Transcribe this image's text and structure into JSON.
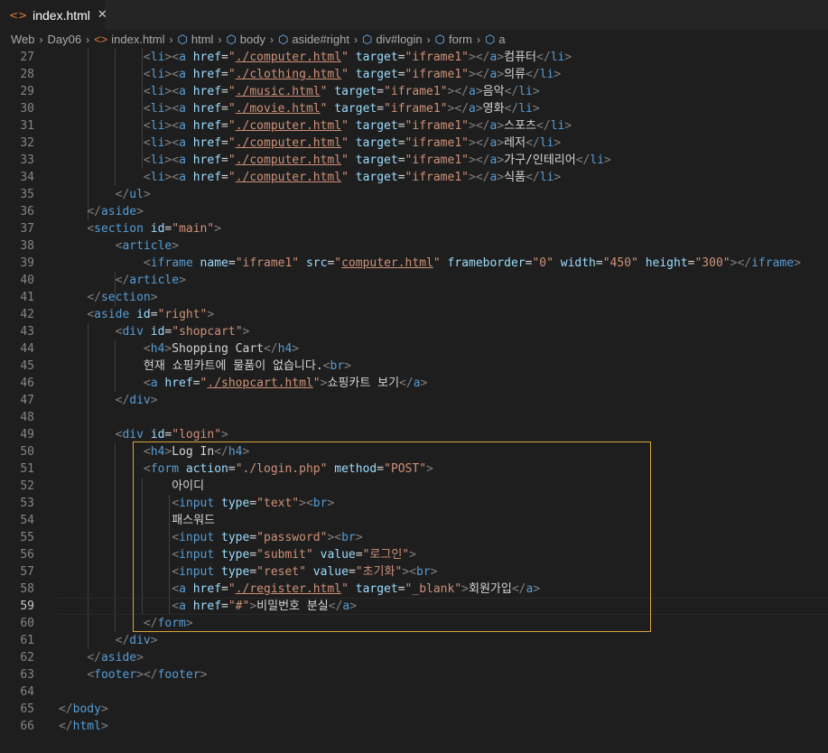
{
  "tab": {
    "icon": "html-file-icon",
    "label": "index.html",
    "close": "✕"
  },
  "breadcrumb": [
    {
      "label": "Web",
      "icon": ""
    },
    {
      "label": "Day06",
      "icon": ""
    },
    {
      "label": "index.html",
      "icon": "html-file-icon"
    },
    {
      "label": "html",
      "icon": "element-cube-icon"
    },
    {
      "label": "body",
      "icon": "element-cube-icon"
    },
    {
      "label": "aside#right",
      "icon": "element-cube-icon"
    },
    {
      "label": "div#login",
      "icon": "element-cube-icon"
    },
    {
      "label": "form",
      "icon": "element-cube-icon"
    },
    {
      "label": "a",
      "icon": "element-cube-icon"
    }
  ],
  "colors": {
    "tag_bracket": "#808080",
    "tag_name": "#569cd6",
    "attr": "#9cdcfe",
    "string": "#ce9178",
    "text": "#d4d4d4",
    "selection_border": "#d7a53a"
  },
  "current_line": 59,
  "lines": [
    {
      "num": "27",
      "text": "            <li><a href=\"./computer.html\" target=\"iframe1\"></a>컴퓨터</li>"
    },
    {
      "num": "28",
      "text": "            <li><a href=\"./clothing.html\" target=\"iframe1\"></a>의류</li>"
    },
    {
      "num": "29",
      "text": "            <li><a href=\"./music.html\" target=\"iframe1\"></a>음악</li>"
    },
    {
      "num": "30",
      "text": "            <li><a href=\"./movie.html\" target=\"iframe1\"></a>영화</li>"
    },
    {
      "num": "31",
      "text": "            <li><a href=\"./computer.html\" target=\"iframe1\"></a>스포츠</li>"
    },
    {
      "num": "32",
      "text": "            <li><a href=\"./computer.html\" target=\"iframe1\"></a>레저</li>"
    },
    {
      "num": "33",
      "text": "            <li><a href=\"./computer.html\" target=\"iframe1\"></a>가구/인테리어</li>"
    },
    {
      "num": "34",
      "text": "            <li><a href=\"./computer.html\" target=\"iframe1\"></a>식품</li>"
    },
    {
      "num": "35",
      "text": "        </ul>"
    },
    {
      "num": "36",
      "text": "    </aside>"
    },
    {
      "num": "37",
      "text": "    <section id=\"main\">"
    },
    {
      "num": "38",
      "text": "        <article>"
    },
    {
      "num": "39",
      "text": "            <iframe name=\"iframe1\" src=\"computer.html\" frameborder=\"0\" width=\"450\" height=\"300\"></iframe>"
    },
    {
      "num": "40",
      "text": "        </article>"
    },
    {
      "num": "41",
      "text": "    </section>"
    },
    {
      "num": "42",
      "text": "    <aside id=\"right\">"
    },
    {
      "num": "43",
      "text": "        <div id=\"shopcart\">"
    },
    {
      "num": "44",
      "text": "            <h4>Shopping Cart</h4>"
    },
    {
      "num": "45",
      "text": "            현재 쇼핑카트에 물품이 없습니다.<br>"
    },
    {
      "num": "46",
      "text": "            <a href=\"./shopcart.html\">쇼핑카트 보기</a>"
    },
    {
      "num": "47",
      "text": "        </div>"
    },
    {
      "num": "48",
      "text": ""
    },
    {
      "num": "49",
      "text": "        <div id=\"login\">"
    },
    {
      "num": "50",
      "text": "            <h4>Log In</h4>"
    },
    {
      "num": "51",
      "text": "            <form action=\"./login.php\" method=\"POST\">"
    },
    {
      "num": "52",
      "text": "                아이디"
    },
    {
      "num": "53",
      "text": "                <input type=\"text\"><br>"
    },
    {
      "num": "54",
      "text": "                패스워드"
    },
    {
      "num": "55",
      "text": "                <input type=\"password\"><br>"
    },
    {
      "num": "56",
      "text": "                <input type=\"submit\" value=\"로그인\">"
    },
    {
      "num": "57",
      "text": "                <input type=\"reset\" value=\"초기화\"><br>"
    },
    {
      "num": "58",
      "text": "                <a href=\"./register.html\" target=\"_blank\">회원가입</a>"
    },
    {
      "num": "59",
      "text": "                <a href=\"#\">비밀번호 분실</a>"
    },
    {
      "num": "60",
      "text": "            </form>"
    },
    {
      "num": "61",
      "text": "        </div>"
    },
    {
      "num": "62",
      "text": "    </aside>"
    },
    {
      "num": "63",
      "text": "    <footer></footer>"
    },
    {
      "num": "64",
      "text": ""
    },
    {
      "num": "65",
      "text": "</body>"
    },
    {
      "num": "66",
      "text": "</html>"
    }
  ]
}
